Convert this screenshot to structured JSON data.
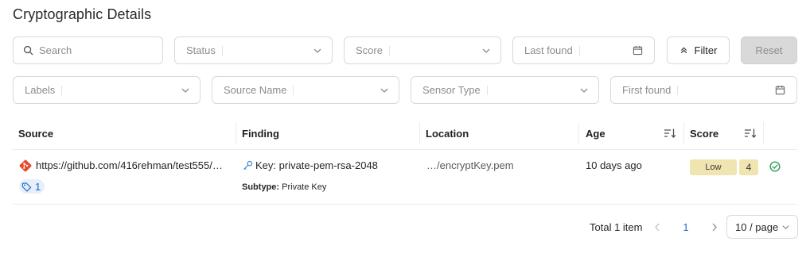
{
  "page": {
    "title": "Cryptographic Details"
  },
  "filters": {
    "search_placeholder": "Search",
    "status_placeholder": "Status",
    "score_placeholder": "Score",
    "last_found_placeholder": "Last found",
    "labels_placeholder": "Labels",
    "source_name_placeholder": "Source Name",
    "sensor_type_placeholder": "Sensor Type",
    "first_found_placeholder": "First found",
    "filter_label": "Filter",
    "reset_label": "Reset"
  },
  "table": {
    "columns": [
      "Source",
      "Finding",
      "Location",
      "Age",
      "Score"
    ],
    "rows": [
      {
        "source_url": "https://github.com/416rehman/test555/…",
        "tag_count": "1",
        "finding": "Key: private-pem-rsa-2048",
        "subtype_label": "Subtype:",
        "subtype_value": "Private Key",
        "location": "…/encryptKey.pem",
        "age": "10 days ago",
        "score_level": "Low",
        "score_value": "4"
      }
    ]
  },
  "pagination": {
    "total": "Total 1 item",
    "current_page": "1",
    "page_size": "10 / page"
  },
  "colors": {
    "accent": "#1a66c9",
    "score_low": "#f0e4b0",
    "git": "#e64a2e",
    "check": "#2f9e5a"
  },
  "icons": [
    "search-icon",
    "chevron-down-icon",
    "calendar-icon",
    "double-chevron-up-icon",
    "sort-icon",
    "git-icon",
    "tag-icon",
    "key-icon",
    "check-circle-icon",
    "chevron-left-icon",
    "chevron-right-icon"
  ]
}
